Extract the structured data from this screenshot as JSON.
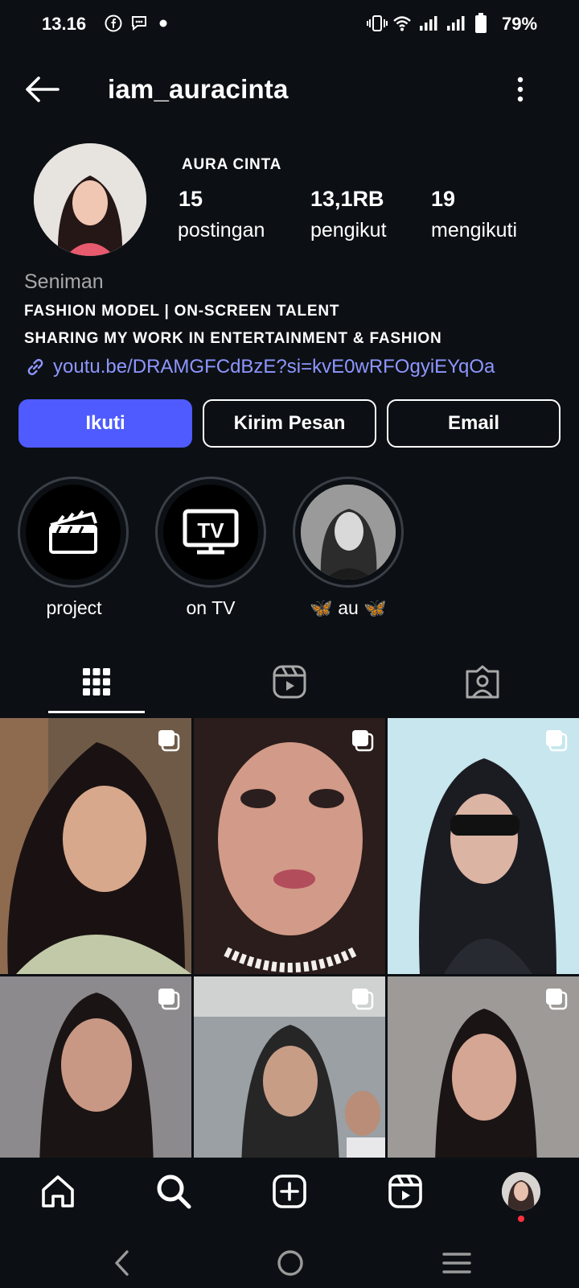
{
  "status_bar": {
    "time": "13.16",
    "battery": "79%"
  },
  "header": {
    "username": "iam_auracinta"
  },
  "profile": {
    "display_name": "AURA CINTA",
    "stats": [
      {
        "value": "15",
        "label": "postingan"
      },
      {
        "value": "13,1RB",
        "label": "pengikut"
      },
      {
        "value": "19",
        "label": "mengikuti"
      }
    ],
    "category": "Seniman",
    "bio_lines": [
      "FASHION MODEL | ON-SCREEN TALENT",
      "SHARING MY WORK IN ENTERTAINMENT & FASHION"
    ],
    "link": "youtu.be/DRAMGFCdBzE?si=kvE0wRFOgyiEYqOa"
  },
  "buttons": {
    "follow": "Ikuti",
    "message": "Kirim Pesan",
    "email": "Email"
  },
  "highlights": [
    {
      "label": "project",
      "icon": "clapperboard-icon"
    },
    {
      "label": "on TV",
      "icon": "tv-icon"
    },
    {
      "label": "🦋 au 🦋",
      "icon": "photo"
    }
  ],
  "tabs": [
    {
      "name": "grid",
      "icon": "grid-icon",
      "active": true
    },
    {
      "name": "reels",
      "icon": "reels-icon",
      "active": false
    },
    {
      "name": "tagged",
      "icon": "tagged-icon",
      "active": false
    }
  ],
  "posts_count_visible": 6,
  "bottom_nav": [
    "home-icon",
    "search-icon",
    "create-icon",
    "reels-icon",
    "profile-avatar"
  ],
  "colors": {
    "background": "#0c1014",
    "accent": "#4f5bff",
    "link": "#8e96ff",
    "notification_dot": "#ff3040"
  }
}
